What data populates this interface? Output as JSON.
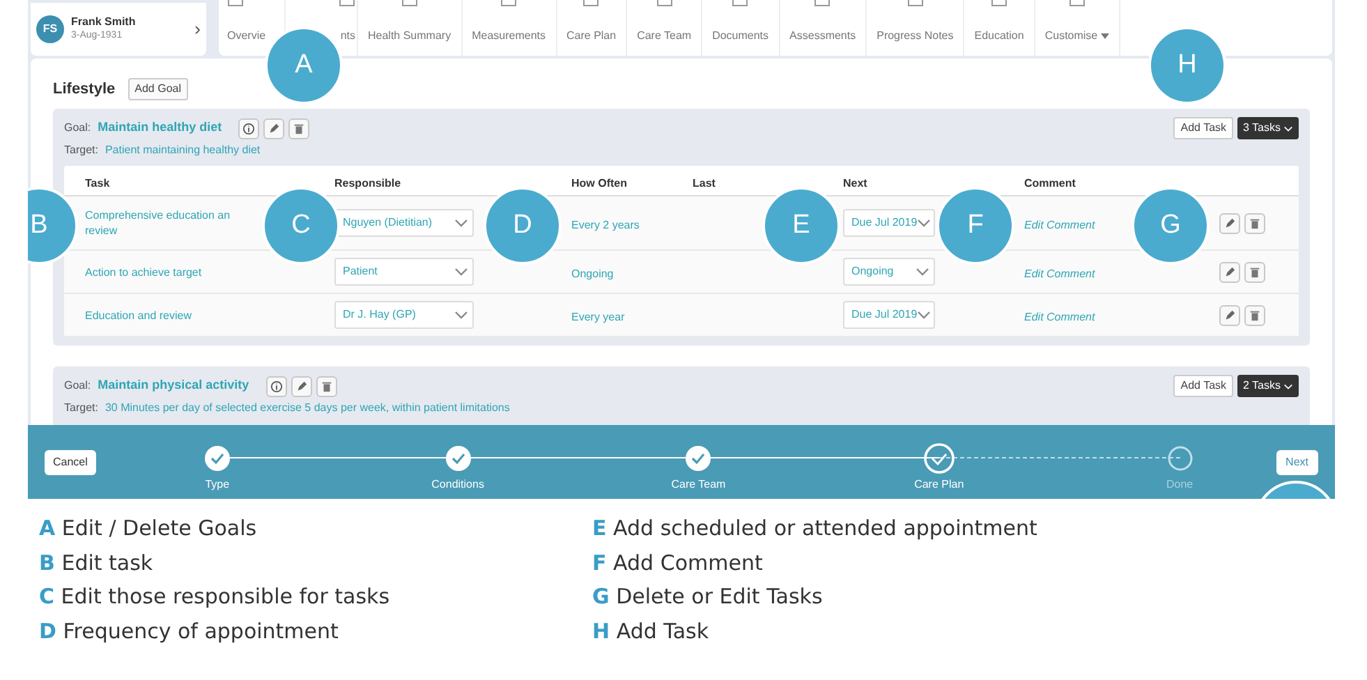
{
  "patient": {
    "initials": "FS",
    "name": "Frank Smith",
    "dob": "3-Aug-1931",
    "chevron": "›"
  },
  "nav_tabs": [
    "Overvie",
    "nts",
    "Health Summary",
    "Measurements",
    "Care Plan",
    "Care Team",
    "Documents",
    "Assessments",
    "Progress Notes",
    "Education",
    "Customise"
  ],
  "section": {
    "title": "Lifestyle",
    "add_button": "Add Goal"
  },
  "goals": [
    {
      "goal_label": "Goal:",
      "title": "Maintain healthy diet",
      "target_label": "Target:",
      "target": "Patient maintaining healthy diet",
      "add_task": "Add Task",
      "tasks_button": "3 Tasks",
      "columns": [
        "Task",
        "Responsible",
        "How Often",
        "Last",
        "Next",
        "Comment"
      ],
      "rows": [
        {
          "task": "Comprehensive education an\nreview",
          "responsible": "Nguyen (Dietitian)",
          "how_often": "Every 2 years",
          "next": "Due Jul 2019",
          "comment": "Edit Comment"
        },
        {
          "task": "Action to achieve target",
          "responsible": "Patient",
          "how_often": "Ongoing",
          "next": "Ongoing",
          "comment": "Edit Comment"
        },
        {
          "task": "Education and review",
          "responsible": "Dr J. Hay (GP)",
          "how_often": "Every year",
          "next": "Due Jul 2019",
          "comment": "Edit Comment"
        }
      ]
    },
    {
      "goal_label": "Goal:",
      "title": "Maintain physical activity",
      "target_label": "Target:",
      "target": "30 Minutes per day of selected exercise 5 days per week, within patient limitations",
      "add_task": "Add Task",
      "tasks_button": "2 Tasks"
    }
  ],
  "wizard": {
    "cancel": "Cancel",
    "next": "Next",
    "steps": [
      {
        "label": "Type",
        "completed": true,
        "selected": false
      },
      {
        "label": "Conditions",
        "completed": true,
        "selected": false
      },
      {
        "label": "Care Team",
        "completed": true,
        "selected": false
      },
      {
        "label": "Care Plan",
        "completed": false,
        "selected": true
      },
      {
        "label": "Done",
        "completed": false,
        "selected": false
      }
    ]
  },
  "callouts": [
    "A",
    "H",
    "B",
    "C",
    "D",
    "E",
    "F",
    "G"
  ],
  "legend": [
    {
      "letter": "A",
      "text": "Edit / Delete Goals"
    },
    {
      "letter": "B",
      "text": "Edit task"
    },
    {
      "letter": "C",
      "text": "Edit those responsible for tasks"
    },
    {
      "letter": "D",
      "text": "Frequency of appointment"
    },
    {
      "letter": "E",
      "text": "Add scheduled or attended appointment"
    },
    {
      "letter": "F",
      "text": "Add Comment"
    },
    {
      "letter": "G",
      "text": "Delete or Edit Tasks"
    },
    {
      "letter": "H",
      "text": "Add Task"
    }
  ]
}
